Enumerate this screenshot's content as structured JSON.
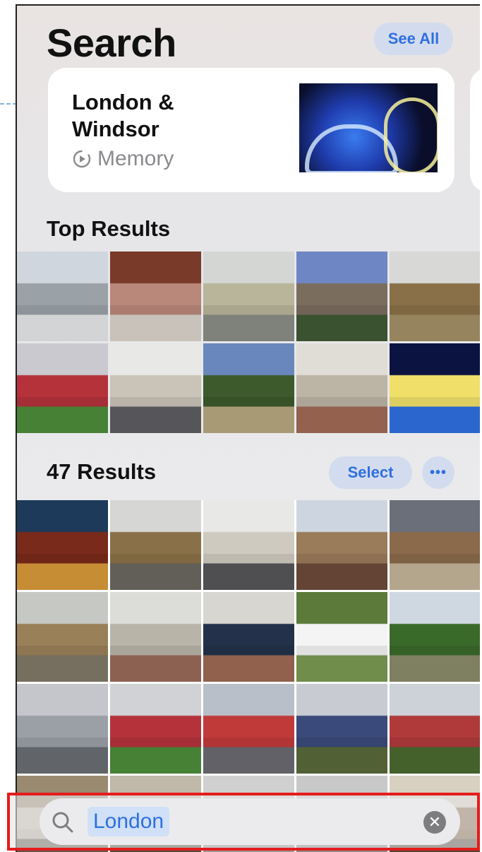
{
  "header": {
    "title": "Search",
    "see_all_label": "See All"
  },
  "memory_card": {
    "title": "London & Windsor",
    "subtitle": "Memory",
    "subtitle_icon": "memory-replay-icon"
  },
  "top_results": {
    "title": "Top Results",
    "photos": [
      {
        "colors": [
          "#cfd6dd",
          "#9aa2a8",
          "#e4e6e8"
        ]
      },
      {
        "colors": [
          "#7a3a2a",
          "#b9887a",
          "#d9d3cb"
        ]
      },
      {
        "colors": [
          "#d4d6d3",
          "#b9b59a",
          "#8a8d86"
        ]
      },
      {
        "colors": [
          "#6f86c5",
          "#7b6d5e",
          "#3f5a34"
        ]
      },
      {
        "colors": [
          "#d8d8d6",
          "#8a7048",
          "#a39067"
        ]
      },
      {
        "colors": [
          "#c9c9cf",
          "#b5323b",
          "#4c8c3a"
        ]
      },
      {
        "colors": [
          "#e8e8e6",
          "#c9c3b8",
          "#5e5e62"
        ]
      },
      {
        "colors": [
          "#6a87bd",
          "#3d5a2c",
          "#b8a880"
        ]
      },
      {
        "colors": [
          "#e0ddd6",
          "#bcb4a4",
          "#a06a55"
        ]
      },
      {
        "colors": [
          "#0b1440",
          "#f0e06a",
          "#2f6fe0"
        ]
      }
    ]
  },
  "results": {
    "title": "47 Results",
    "select_label": "Select",
    "more_label": "•••",
    "photos": [
      {
        "colors": [
          "#1d3a5a",
          "#7a2a1a",
          "#d79a3a"
        ]
      },
      {
        "colors": [
          "#d6d6d4",
          "#8a7048",
          "#6a6860"
        ]
      },
      {
        "colors": [
          "#e8e8e6",
          "#cfcabf",
          "#56565a"
        ]
      },
      {
        "colors": [
          "#cdd6e0",
          "#9a7b5a",
          "#6c4a3a"
        ]
      },
      {
        "colors": [
          "#6a6f7a",
          "#8a6a4a",
          "#c4b49a"
        ]
      },
      {
        "colors": [
          "#c6c8c4",
          "#9a8058",
          "#807868"
        ]
      },
      {
        "colors": [
          "#dcdcd8",
          "#b9b4a8",
          "#9a6a58"
        ]
      },
      {
        "colors": [
          "#d8d6d0",
          "#23324a",
          "#9e6a54"
        ]
      },
      {
        "colors": [
          "#5c7a3a",
          "#f4f4f4",
          "#7a9a52"
        ]
      },
      {
        "colors": [
          "#cfd8e0",
          "#3a6a2a",
          "#8a8a6a"
        ]
      },
      {
        "colors": [
          "#c4c6cc",
          "#9aa0a6",
          "#6a6e72"
        ]
      },
      {
        "colors": [
          "#d0d2d6",
          "#b5323b",
          "#4c8c3a"
        ]
      },
      {
        "colors": [
          "#b8bfc8",
          "#c03a3a",
          "#6a6a70"
        ]
      },
      {
        "colors": [
          "#c8ccd2",
          "#3a4a7a",
          "#5a6a3a"
        ]
      },
      {
        "colors": [
          "#cdd2d8",
          "#b03a3a",
          "#4a6a30"
        ]
      },
      {
        "colors": [
          "#9a8a70",
          "#c8c0b0",
          "#6a6050"
        ]
      },
      {
        "colors": [
          "#c0b8a8",
          "#8a7a60",
          "#5a5244"
        ]
      },
      {
        "colors": [
          "#d0d0d0",
          "#bababa",
          "#a8a8a8"
        ]
      },
      {
        "colors": [
          "#c8c8c8",
          "#b0b0b0",
          "#9a9a9a"
        ]
      },
      {
        "colors": [
          "#d8d0c0",
          "#8a6a4a",
          "#5a4a3a"
        ]
      }
    ]
  },
  "search": {
    "query_token": "London",
    "search_icon": "magnifier-icon",
    "clear_icon": "clear-x-icon",
    "clear_glyph": "✕"
  }
}
